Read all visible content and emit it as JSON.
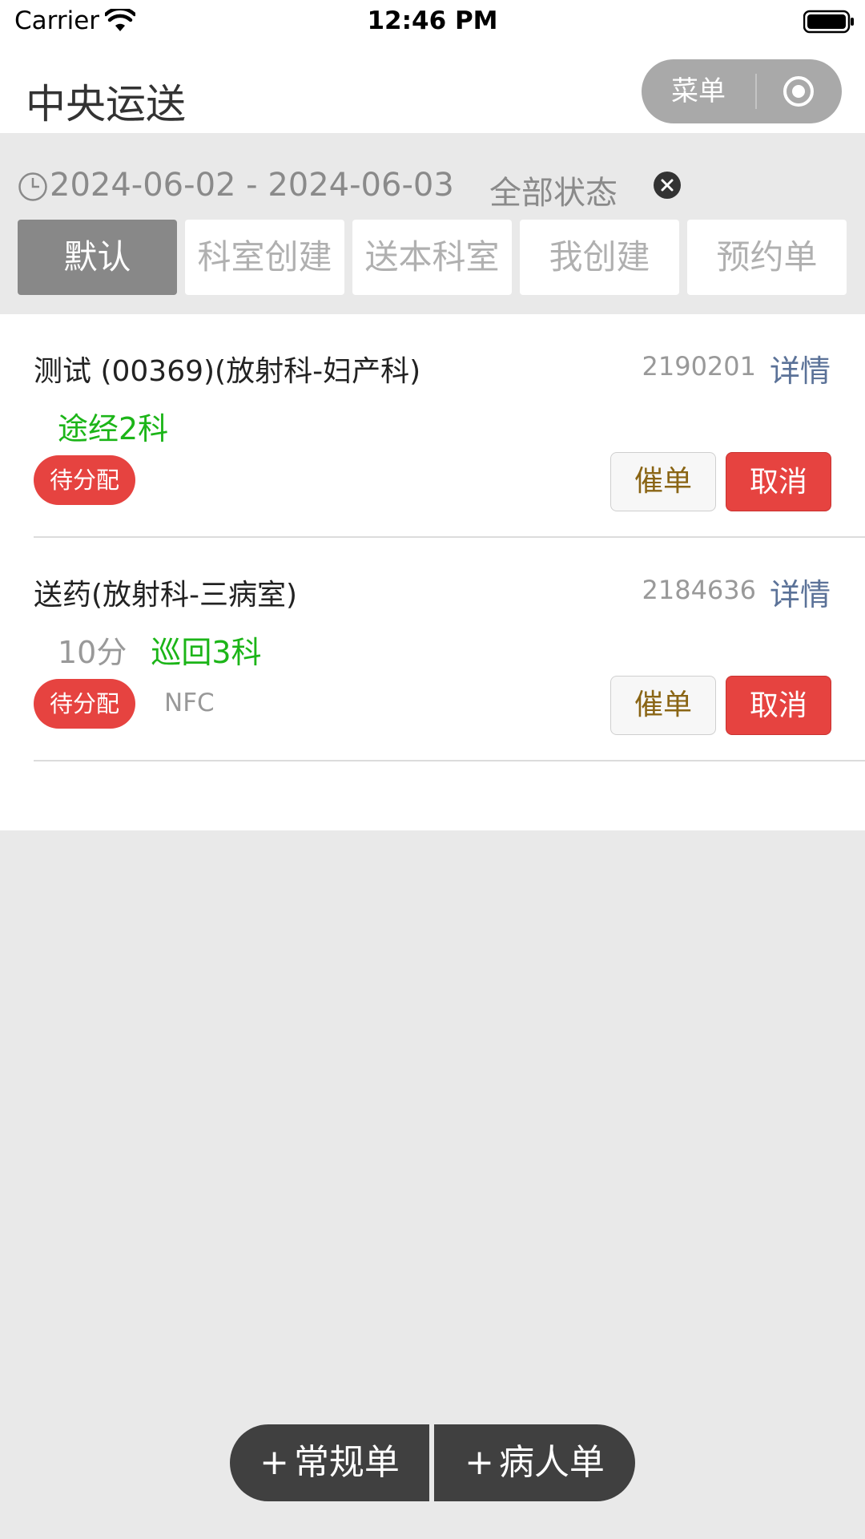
{
  "status_bar": {
    "carrier": "Carrier",
    "time": "12:46 PM"
  },
  "nav": {
    "title": "中央运送",
    "menu_label": "菜单"
  },
  "filter": {
    "date_range": "2024-06-02 - 2024-06-03",
    "status": "全部状态"
  },
  "tabs": [
    {
      "label": "默认",
      "active": true
    },
    {
      "label": "科室创建"
    },
    {
      "label": "送本科室"
    },
    {
      "label": "我创建"
    },
    {
      "label": "预约单"
    }
  ],
  "items": [
    {
      "title": "测试 (00369)(放射科-妇产科)",
      "id": "2190201",
      "detail_label": "详情",
      "time": "",
      "route": "途经2科",
      "badge": "待分配",
      "extra": "",
      "urge_label": "催单",
      "cancel_label": "取消"
    },
    {
      "title": "送药(放射科-三病室)",
      "id": "2184636",
      "detail_label": "详情",
      "time": "10分",
      "route": "巡回3科",
      "badge": "待分配",
      "extra": "NFC",
      "urge_label": "催单",
      "cancel_label": "取消"
    }
  ],
  "bottom": {
    "plus": "+",
    "normal_order": "常规单",
    "patient_order": "病人单"
  },
  "colors": {
    "accent_red": "#e64340",
    "route_green": "#1cb518",
    "link_blue": "#5b7298",
    "urge_text": "#8a6515",
    "tab_active": "#888888"
  }
}
